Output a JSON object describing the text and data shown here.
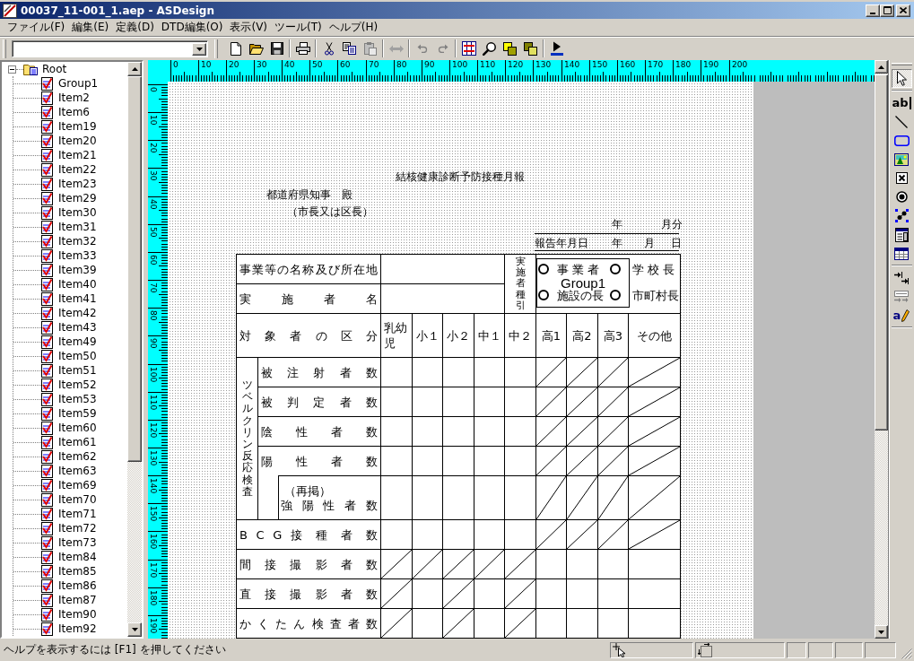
{
  "window": {
    "title": "00037_11-001_1.aep - ASDesign"
  },
  "menu": [
    "ファイル(F)",
    "編集(E)",
    "定義(D)",
    "DTD編集(O)",
    "表示(V)",
    "ツール(T)",
    "ヘルプ(H)"
  ],
  "toolbar": [
    {
      "kind": "new",
      "disabled": false
    },
    {
      "kind": "open",
      "disabled": false
    },
    {
      "kind": "save",
      "disabled": false
    },
    {
      "kind": "separator"
    },
    {
      "kind": "print",
      "disabled": false
    },
    {
      "kind": "separator"
    },
    {
      "kind": "cut",
      "disabled": false
    },
    {
      "kind": "copy",
      "disabled": false
    },
    {
      "kind": "paste",
      "disabled": true
    },
    {
      "kind": "separator"
    },
    {
      "kind": "swap",
      "disabled": true
    },
    {
      "kind": "separator"
    },
    {
      "kind": "undo",
      "disabled": true
    },
    {
      "kind": "redo",
      "disabled": true
    },
    {
      "kind": "separator"
    },
    {
      "kind": "grid",
      "disabled": false
    },
    {
      "kind": "search",
      "disabled": false
    },
    {
      "kind": "bring-front",
      "disabled": false
    },
    {
      "kind": "send-back",
      "disabled": false
    },
    {
      "kind": "separator"
    },
    {
      "kind": "run",
      "disabled": false
    }
  ],
  "tree": {
    "label": "Root",
    "expanded": true,
    "selected": false,
    "children": [
      {
        "label": "Group1",
        "selected": false
      },
      {
        "label": "Item2",
        "selected": false
      },
      {
        "label": "Item6",
        "selected": false
      },
      {
        "label": "Item19",
        "selected": false
      },
      {
        "label": "Item20",
        "selected": false
      },
      {
        "label": "Item21",
        "selected": false
      },
      {
        "label": "Item22",
        "selected": false
      },
      {
        "label": "Item23",
        "selected": false
      },
      {
        "label": "Item29",
        "selected": false
      },
      {
        "label": "Item30",
        "selected": false
      },
      {
        "label": "Item31",
        "selected": false
      },
      {
        "label": "Item32",
        "selected": false
      },
      {
        "label": "Item33",
        "selected": false
      },
      {
        "label": "Item39",
        "selected": false
      },
      {
        "label": "Item40",
        "selected": false
      },
      {
        "label": "Item41",
        "selected": false
      },
      {
        "label": "Item42",
        "selected": false
      },
      {
        "label": "Item43",
        "selected": false
      },
      {
        "label": "Item49",
        "selected": false
      },
      {
        "label": "Item50",
        "selected": false
      },
      {
        "label": "Item51",
        "selected": false
      },
      {
        "label": "Item52",
        "selected": false
      },
      {
        "label": "Item53",
        "selected": false
      },
      {
        "label": "Item59",
        "selected": false
      },
      {
        "label": "Item60",
        "selected": false
      },
      {
        "label": "Item61",
        "selected": false
      },
      {
        "label": "Item62",
        "selected": false
      },
      {
        "label": "Item63",
        "selected": false
      },
      {
        "label": "Item69",
        "selected": false
      },
      {
        "label": "Item70",
        "selected": false
      },
      {
        "label": "Item71",
        "selected": false
      },
      {
        "label": "Item72",
        "selected": false
      },
      {
        "label": "Item73",
        "selected": false
      },
      {
        "label": "Item84",
        "selected": false
      },
      {
        "label": "Item85",
        "selected": false
      },
      {
        "label": "Item86",
        "selected": false
      },
      {
        "label": "Item87",
        "selected": false
      },
      {
        "label": "Item90",
        "selected": false
      },
      {
        "label": "Item92",
        "selected": false
      }
    ]
  },
  "ruler": {
    "horizontal": [
      "0",
      "10",
      "20",
      "30",
      "40",
      "50",
      "60",
      "70",
      "80",
      "90",
      "100",
      "110",
      "120",
      "130",
      "140",
      "150",
      "160",
      "170",
      "180",
      "190",
      "200"
    ],
    "vertical": [
      "0",
      "10",
      "20",
      "30",
      "40",
      "50",
      "60",
      "70",
      "80",
      "90",
      "100",
      "110",
      "120",
      "130",
      "140",
      "150",
      "160",
      "170",
      "180",
      "190"
    ]
  },
  "document": {
    "title": "結核健康診断予防接種月報",
    "addressee": "都道府県知事　殿",
    "addressee_note": "（市長又は区長）",
    "period": {
      "parts": [
        "年",
        "月分"
      ]
    },
    "report_date": {
      "label": "報告年月日",
      "parts": [
        "年",
        "月",
        "日"
      ]
    },
    "table": {
      "name_rows": [
        {
          "label": "事業等の名称及び所在地"
        },
        {
          "label": "実 施 者 名"
        }
      ],
      "operator_type": {
        "label": "実施者種引",
        "group_label": "Group1",
        "options": [
          {
            "label": "事 業 者",
            "selected": false
          },
          {
            "label": "学 校 長",
            "selected": false
          },
          {
            "label": "施設の長",
            "selected": false
          },
          {
            "label": "市町村長",
            "selected": false
          }
        ]
      },
      "category_label": "対 象 者 の 区 分",
      "columns": [
        "乳幼児",
        "小１",
        "小２",
        "中１",
        "中２",
        "高1",
        "高2",
        "高3",
        "その他"
      ],
      "tuberculin": {
        "label": "ツベルクリン反応検査",
        "rows": [
          {
            "label": "被 注 射 者 数",
            "cells": [
              {
                "slashed": false
              },
              {
                "slashed": false
              },
              {
                "slashed": false
              },
              {
                "slashed": false
              },
              {
                "slashed": false
              },
              {
                "slashed": true
              },
              {
                "slashed": true
              },
              {
                "slashed": true
              },
              {
                "slashed": true
              }
            ]
          },
          {
            "label": "被 判 定 者 数",
            "cells": [
              {
                "slashed": false
              },
              {
                "slashed": false
              },
              {
                "slashed": false
              },
              {
                "slashed": false
              },
              {
                "slashed": false
              },
              {
                "slashed": true
              },
              {
                "slashed": true
              },
              {
                "slashed": true
              },
              {
                "slashed": true
              }
            ]
          },
          {
            "label": "陰 性 者 数",
            "cells": [
              {
                "slashed": false
              },
              {
                "slashed": false
              },
              {
                "slashed": false
              },
              {
                "slashed": false
              },
              {
                "slashed": false
              },
              {
                "slashed": true
              },
              {
                "slashed": true
              },
              {
                "slashed": true
              },
              {
                "slashed": true
              }
            ]
          },
          {
            "label": "陽 性 者 数",
            "cells": [
              {
                "slashed": false
              },
              {
                "slashed": false
              },
              {
                "slashed": false
              },
              {
                "slashed": false
              },
              {
                "slashed": false
              },
              {
                "slashed": true
              },
              {
                "slashed": true
              },
              {
                "slashed": true
              },
              {
                "slashed": true
              }
            ]
          },
          {
            "note": "（再掲）",
            "label": "強 陽 性 者 数",
            "cells": [
              {
                "slashed": false
              },
              {
                "slashed": false
              },
              {
                "slashed": false
              },
              {
                "slashed": false
              },
              {
                "slashed": false
              },
              {
                "slashed": true
              },
              {
                "slashed": true
              },
              {
                "slashed": true
              },
              {
                "slashed": true
              }
            ]
          }
        ]
      },
      "rows": [
        {
          "label": "B C G 接 種 者 数",
          "cells": [
            {
              "slashed": false
            },
            {
              "slashed": false
            },
            {
              "slashed": false
            },
            {
              "slashed": false
            },
            {
              "slashed": false
            },
            {
              "slashed": true
            },
            {
              "slashed": true
            },
            {
              "slashed": true
            },
            {
              "slashed": true
            }
          ]
        },
        {
          "label": "間 接 撮 影 者 数",
          "cells": [
            {
              "slashed": true
            },
            {
              "slashed": true
            },
            {
              "slashed": true
            },
            {
              "slashed": true
            },
            {
              "slashed": true
            },
            {
              "slashed": false
            },
            {
              "slashed": false
            },
            {
              "slashed": false
            },
            {
              "slashed": false
            }
          ]
        },
        {
          "label": "直 接 撮 影 者 数",
          "cells": [
            {
              "slashed": true
            },
            {
              "slashed": false
            },
            {
              "slashed": true
            },
            {
              "slashed": false
            },
            {
              "slashed": true
            },
            {
              "slashed": false
            },
            {
              "slashed": false
            },
            {
              "slashed": false
            },
            {
              "slashed": false
            }
          ]
        },
        {
          "label": "か く た ん 検 査 者 数",
          "cells": [
            {
              "slashed": true
            },
            {
              "slashed": false
            },
            {
              "slashed": true
            },
            {
              "slashed": false
            },
            {
              "slashed": true
            },
            {
              "slashed": false
            },
            {
              "slashed": false
            },
            {
              "slashed": false
            },
            {
              "slashed": false
            }
          ]
        }
      ]
    }
  },
  "tools": [
    {
      "kind": "pointer",
      "selected": true,
      "disabled": false
    },
    {
      "kind": "separator"
    },
    {
      "kind": "text",
      "glyph": "ab",
      "selected": false,
      "disabled": false
    },
    {
      "kind": "line",
      "selected": false,
      "disabled": false
    },
    {
      "kind": "rectangle",
      "selected": false,
      "disabled": false
    },
    {
      "kind": "image",
      "selected": false,
      "disabled": false
    },
    {
      "kind": "checkbox",
      "selected": false,
      "disabled": false
    },
    {
      "kind": "radio",
      "selected": false,
      "disabled": false
    },
    {
      "kind": "connector",
      "selected": false,
      "disabled": false
    },
    {
      "kind": "form",
      "selected": false,
      "disabled": false
    },
    {
      "kind": "table",
      "selected": false,
      "disabled": false
    },
    {
      "kind": "separator"
    },
    {
      "kind": "tab-order",
      "selected": false,
      "disabled": false
    },
    {
      "kind": "field-order",
      "selected": false,
      "disabled": true
    },
    {
      "kind": "text-edit",
      "glyph": "a",
      "selected": false,
      "disabled": false
    },
    {
      "kind": "separator"
    }
  ],
  "status_bar": {
    "message": "ヘルプを表示するには [F1] を押してください"
  }
}
